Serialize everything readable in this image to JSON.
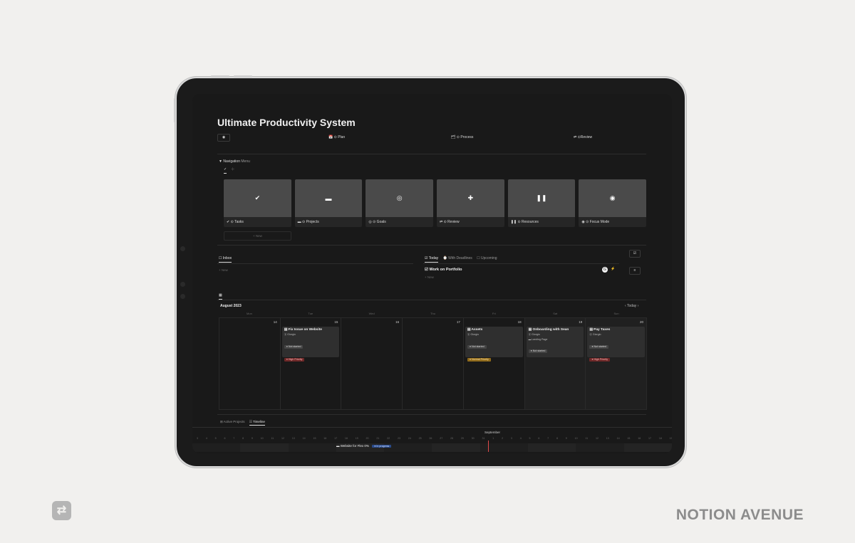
{
  "page": {
    "title": "Ultimate Productivity System",
    "top_nav": {
      "eye": "◉",
      "plan": "📅 ⊙ Plan",
      "process": "🗂 ⊙ Process",
      "review": "⇄ ⊙Review"
    }
  },
  "navigation_menu": {
    "label_strong": "Navigation",
    "label_muted": "Menu",
    "toggle": "▼",
    "view_tabs": [
      "✓",
      "⊹"
    ],
    "cards": [
      {
        "icon": "✔",
        "label": "✔ ⊙ Tasks"
      },
      {
        "icon": "▬",
        "label": "▬ ⊙ Projects"
      },
      {
        "icon": "◎",
        "label": "◎ ⊙ Goals"
      },
      {
        "icon": "✚",
        "label": "⇄ ⊙ Review"
      },
      {
        "icon": "❚❚",
        "label": "❚❚ ⊙ Resources"
      },
      {
        "icon": "◉",
        "label": "◉ ⊙ Focus Mode"
      }
    ],
    "new_label": "+ New"
  },
  "inbox": {
    "tab": "☐ Inbox",
    "new": "+ New"
  },
  "today": {
    "tabs": [
      "☑ Today",
      "⌚ With Deadlines",
      "☐ Upcoming"
    ],
    "task": "☑ Work on Portfolio",
    "avatar": "G",
    "new": "+ New",
    "buttons": [
      "☑",
      "≡"
    ]
  },
  "calendar": {
    "view_icon": "▦",
    "month": "August 2023",
    "nav": "‹ Today ›",
    "weekdays": [
      "Mon",
      "Tue",
      "Wed",
      "Thu",
      "Fri",
      "Sat",
      "Sun"
    ],
    "days": [
      {
        "num": "14",
        "event": null
      },
      {
        "num": "15",
        "event": {
          "title": "▤ Fix Issue on Website",
          "meta": "ⓖ Giorgio",
          "tags": [
            {
              "text": "● Not started",
              "kind": "ns"
            },
            {
              "text": "● High Priority",
              "kind": "high"
            }
          ]
        }
      },
      {
        "num": "16",
        "event": null
      },
      {
        "num": "17",
        "event": null
      },
      {
        "num": "18",
        "event": {
          "title": "▤ Assets",
          "meta": "ⓖ Giorgio",
          "tags": [
            {
              "text": "● Not started",
              "kind": "ns"
            },
            {
              "text": "● Normal Priority",
              "kind": "normal"
            }
          ]
        }
      },
      {
        "num": "19",
        "event": {
          "title": "▤ Onboarding with Sean",
          "meta": "ⓖ Giorgio",
          "meta2": "▬ Landing Page",
          "tags": [
            {
              "text": "● Not started",
              "kind": "ns"
            }
          ]
        }
      },
      {
        "num": "20",
        "event": {
          "title": "▤ Pay Taxes",
          "meta": "ⓖ Giorgio",
          "tags": [
            {
              "text": "● Not started",
              "kind": "ns"
            },
            {
              "text": "● High Priority",
              "kind": "high"
            }
          ]
        }
      }
    ]
  },
  "projects": {
    "tabs": [
      "⊞ Active Projects",
      "☷ Timeline"
    ],
    "month": "September",
    "days": [
      "3",
      "4",
      "5",
      "6",
      "7",
      "8",
      "9",
      "10",
      "11",
      "12",
      "13",
      "14",
      "15",
      "16",
      "17",
      "18",
      "19",
      "20",
      "21",
      "22",
      "23",
      "24",
      "25",
      "26",
      "27",
      "28",
      "29",
      "30",
      "31",
      "1",
      "2",
      "3",
      "4",
      "5",
      "6",
      "7",
      "8",
      "9",
      "10",
      "11",
      "12",
      "13",
      "14",
      "15",
      "16",
      "17",
      "18",
      "19"
    ],
    "item": "▬ Website for Flex  0%",
    "status": "● In progress"
  },
  "brand": {
    "name": "NOTION AVENUE",
    "icon": "⇄"
  },
  "colors": {
    "background": "#f1f0ee",
    "screen": "#191919",
    "high_priority": "#6e2828",
    "normal_priority": "#8f6a1b",
    "in_progress": "#2a4a8a"
  }
}
